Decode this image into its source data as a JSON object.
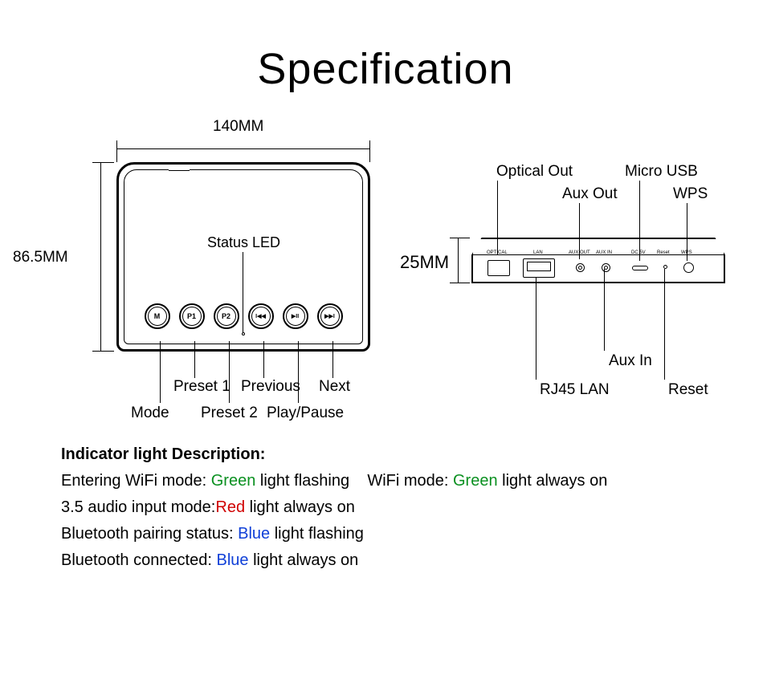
{
  "title": "Specification",
  "dimensions": {
    "width": "140MM",
    "height": "86.5MM",
    "depth": "25MM"
  },
  "top_view": {
    "status_led": "Status LED",
    "buttons": {
      "mode": {
        "symbol": "M",
        "label": "Mode"
      },
      "preset1": {
        "symbol": "P1",
        "label": "Preset 1"
      },
      "preset2": {
        "symbol": "P2",
        "label": "Preset 2"
      },
      "previous": {
        "symbol": "I◀◀",
        "label": "Previous"
      },
      "play_pause": {
        "symbol": "▶II",
        "label": "Play/Pause"
      },
      "next": {
        "symbol": "▶▶I",
        "label": "Next"
      }
    }
  },
  "side_view": {
    "ports": {
      "optical_out": "Optical Out",
      "rj45_lan": "RJ45 LAN",
      "aux_out": "Aux Out",
      "aux_in": "Aux In",
      "micro_usb": "Micro USB",
      "reset": "Reset",
      "wps": "WPS"
    },
    "port_labels_tiny": {
      "optical": "OPTICAL",
      "lan": "LAN",
      "aux_out": "AUX OUT",
      "aux_in": "AUX IN",
      "dc5v": "DC 5V",
      "reset": "Reset",
      "wps": "WPS"
    }
  },
  "indicator": {
    "header": "Indicator light Description:",
    "line1a": "Entering WiFi mode: ",
    "line1b": "Green",
    "line1c": " light flashing",
    "line1_gap": "   ",
    "line1d": "WiFi mode: ",
    "line1e": "Green",
    "line1f": " light always on",
    "line2a": "3.5 audio input mode:",
    "line2b": "Red",
    "line2c": " light always on",
    "line3a": "Bluetooth pairing status: ",
    "line3b": "Blue",
    "line3c": " light flashing",
    "line4a": "Bluetooth connected: ",
    "line4b": "Blue",
    "line4c": " light always on"
  }
}
